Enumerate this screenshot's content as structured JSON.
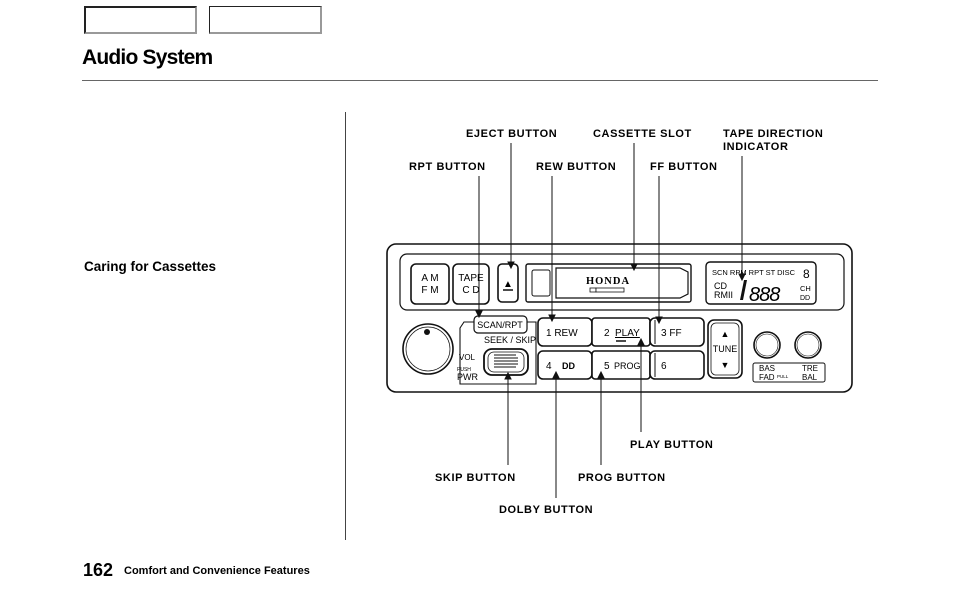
{
  "header": {
    "title": "Audio System",
    "nav_boxes": [
      "",
      ""
    ]
  },
  "sidebar": {
    "heading": "Caring for Cassettes"
  },
  "footer": {
    "page_number": "162",
    "section": "Comfort and Convenience Features"
  },
  "diagram": {
    "callouts": {
      "eject": "EJECT  BUTTON",
      "cassette_slot": "CASSETTE  SLOT",
      "tape_direction_1": "TAPE  DIRECTION",
      "tape_direction_2": "INDICATOR",
      "rpt": "RPT  BUTTON",
      "rew": "REW  BUTTON",
      "ff": "FF  BUTTON",
      "play": "PLAY  BUTTON",
      "skip": "SKIP  BUTTON",
      "prog": "PROG  BUTTON",
      "dolby": "DOLBY  BUTTON"
    },
    "unit": {
      "am_fm_1": "A M",
      "am_fm_2": "F M",
      "tape_cd_1": "TAPE",
      "tape_cd_2": "C D",
      "eject_glyph": "▲",
      "brand": "HONDA",
      "scan_rpt": "SCAN/RPT",
      "seek_skip": "SEEK / SKIP",
      "vol": "VOL",
      "push": "PUSH",
      "pwr": "PWR",
      "preset1": "1  REW",
      "preset2_num": "2",
      "preset2_label": "PLAY",
      "preset3": "3    FF",
      "preset4_num": "4",
      "preset4_label": "DD",
      "preset5_num": "5",
      "preset5_label": "PROG",
      "preset6": "6",
      "tune": "TUNE",
      "tune_up": "▲",
      "tune_down": "▼",
      "bas": "BAS",
      "fad": "FAD",
      "pull": "PULL",
      "tre": "TRE",
      "bal": "BAL",
      "display_top": "SCN RPM RPT ST DISC",
      "display_disc_num": "8",
      "display_cd": "CD",
      "display_rmii": "RMII",
      "display_digits": "888",
      "display_ch": "CH",
      "display_dolby": "DD"
    }
  }
}
